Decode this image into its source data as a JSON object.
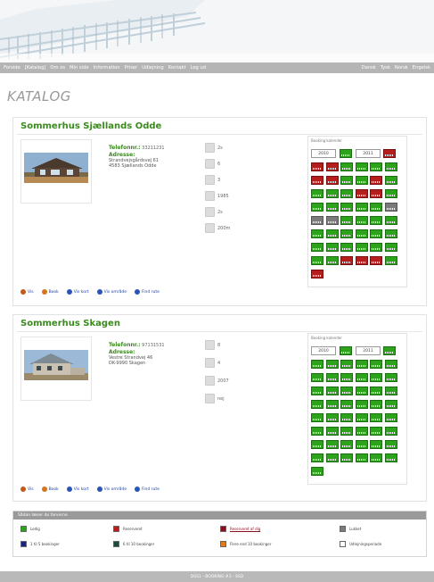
{
  "nav": {
    "left": [
      "Forside",
      "[Katalog]",
      "Om os",
      "Min side",
      "Information",
      "Priser",
      "Udlejning",
      "Kontakt",
      "Log ud"
    ],
    "right": [
      "Dansk",
      "Tysk",
      "Norsk",
      "Engelsk"
    ]
  },
  "page_title": "KATALOG",
  "properties": [
    {
      "title": "Sommerhus Sjællands Odde",
      "phone_label": "Telefonnr.:",
      "phone": "33211231",
      "address_label": "Adresse:",
      "address": [
        "Strandvejsgårdsvej 61",
        "4583 Sjællands Odde"
      ],
      "facts": [
        {
          "icon": "beds-icon",
          "value": "2s"
        },
        {
          "icon": "persons-icon",
          "value": "6"
        },
        {
          "icon": "bath-icon",
          "value": "3"
        },
        {
          "icon": "calendar-icon",
          "value": "1985"
        },
        {
          "icon": "plane-icon",
          "value": "2s"
        },
        {
          "icon": "distance-icon",
          "value": "200m"
        }
      ],
      "calendar": {
        "title": "Booking kalender",
        "years": [
          "2010",
          "2011"
        ],
        "weeks": [
          {
            "n": "",
            "st": "ledig"
          },
          {
            "n": "",
            "st": "reserveret"
          },
          {
            "n": "1",
            "st": "reserveret"
          },
          {
            "n": "2",
            "st": "reserveret"
          },
          {
            "n": "3",
            "st": "ledig"
          },
          {
            "n": "4",
            "st": "ledig"
          },
          {
            "n": "5",
            "st": "ledig"
          },
          {
            "n": "6",
            "st": "ledig"
          },
          {
            "n": "7",
            "st": "reserveret"
          },
          {
            "n": "8",
            "st": "reserveret"
          },
          {
            "n": "9",
            "st": "ledig"
          },
          {
            "n": "10",
            "st": "ledig"
          },
          {
            "n": "11",
            "st": "reserveret"
          },
          {
            "n": "12",
            "st": "ledig"
          },
          {
            "n": "13",
            "st": "ledig"
          },
          {
            "n": "14",
            "st": "ledig"
          },
          {
            "n": "15",
            "st": "ledig"
          },
          {
            "n": "16",
            "st": "reserveret"
          },
          {
            "n": "17",
            "st": "reserveret"
          },
          {
            "n": "18",
            "st": "ledig"
          },
          {
            "n": "19",
            "st": "ledig"
          },
          {
            "n": "20",
            "st": "ledig"
          },
          {
            "n": "21",
            "st": "ledig"
          },
          {
            "n": "22",
            "st": "ledig"
          },
          {
            "n": "23",
            "st": "ledig"
          },
          {
            "n": "24",
            "st": "lukket"
          },
          {
            "n": "25",
            "st": "lukket"
          },
          {
            "n": "26",
            "st": "lukket"
          },
          {
            "n": "27",
            "st": "ledig"
          },
          {
            "n": "28",
            "st": "ledig"
          },
          {
            "n": "29",
            "st": "ledig"
          },
          {
            "n": "30",
            "st": "ledig"
          },
          {
            "n": "31",
            "st": "ledig"
          },
          {
            "n": "32",
            "st": "ledig"
          },
          {
            "n": "33",
            "st": "ledig"
          },
          {
            "n": "34",
            "st": "ledig"
          },
          {
            "n": "35",
            "st": "ledig"
          },
          {
            "n": "36",
            "st": "ledig"
          },
          {
            "n": "37",
            "st": "ledig"
          },
          {
            "n": "38",
            "st": "ledig"
          },
          {
            "n": "39",
            "st": "ledig"
          },
          {
            "n": "40",
            "st": "ledig"
          },
          {
            "n": "41",
            "st": "ledig"
          },
          {
            "n": "42",
            "st": "ledig"
          },
          {
            "n": "43",
            "st": "ledig"
          },
          {
            "n": "44",
            "st": "ledig"
          },
          {
            "n": "45",
            "st": "reserveret"
          },
          {
            "n": "46",
            "st": "reserveret"
          },
          {
            "n": "47",
            "st": "reserveret"
          },
          {
            "n": "48",
            "st": "ledig"
          },
          {
            "n": "49",
            "st": "reserveret"
          }
        ]
      },
      "links": [
        "Vis",
        "Book",
        "Vis kort",
        "Vis område",
        "Find rute"
      ]
    },
    {
      "title": "Sommerhus Skagen",
      "phone_label": "Telefonnr.:",
      "phone": "97131531",
      "address_label": "Adresse:",
      "address": [
        "Vestre Strandvej 46",
        "DK-9990 Skagen"
      ],
      "facts": [
        {
          "icon": "beds-icon",
          "value": "8"
        },
        {
          "icon": "persons-icon",
          "value": "4"
        },
        {
          "icon": "calendar-icon",
          "value": "2007"
        },
        {
          "icon": "plane-icon",
          "value": "nej"
        }
      ],
      "calendar": {
        "title": "Booking kalender",
        "years": [
          "2010",
          "2011"
        ],
        "weeks": [
          {
            "n": "",
            "st": "ledig"
          },
          {
            "n": "",
            "st": "ledig"
          },
          {
            "n": "1",
            "st": "ledig"
          },
          {
            "n": "2",
            "st": "ledig"
          },
          {
            "n": "3",
            "st": "ledig"
          },
          {
            "n": "4",
            "st": "ledig"
          },
          {
            "n": "5",
            "st": "ledig"
          },
          {
            "n": "6",
            "st": "ledig"
          },
          {
            "n": "7",
            "st": "ledig"
          },
          {
            "n": "8",
            "st": "ledig"
          },
          {
            "n": "9",
            "st": "ledig"
          },
          {
            "n": "10",
            "st": "ledig"
          },
          {
            "n": "11",
            "st": "ledig"
          },
          {
            "n": "12",
            "st": "ledig"
          },
          {
            "n": "13",
            "st": "ledig"
          },
          {
            "n": "14",
            "st": "ledig"
          },
          {
            "n": "15",
            "st": "ledig"
          },
          {
            "n": "16",
            "st": "ledig"
          },
          {
            "n": "17",
            "st": "ledig"
          },
          {
            "n": "18",
            "st": "ledig"
          },
          {
            "n": "19",
            "st": "ledig"
          },
          {
            "n": "20",
            "st": "ledig"
          },
          {
            "n": "21",
            "st": "ledig"
          },
          {
            "n": "22",
            "st": "ledig"
          },
          {
            "n": "23",
            "st": "ledig"
          },
          {
            "n": "24",
            "st": "ledig"
          },
          {
            "n": "25",
            "st": "ledig"
          },
          {
            "n": "26",
            "st": "ledig"
          },
          {
            "n": "27",
            "st": "ledig"
          },
          {
            "n": "28",
            "st": "ledig"
          },
          {
            "n": "29",
            "st": "ledig"
          },
          {
            "n": "30",
            "st": "ledig"
          },
          {
            "n": "31",
            "st": "ledig"
          },
          {
            "n": "32",
            "st": "ledig"
          },
          {
            "n": "33",
            "st": "ledig"
          },
          {
            "n": "34",
            "st": "ledig"
          },
          {
            "n": "35",
            "st": "ledig"
          },
          {
            "n": "36",
            "st": "ledig"
          },
          {
            "n": "37",
            "st": "ledig"
          },
          {
            "n": "38",
            "st": "ledig"
          },
          {
            "n": "39",
            "st": "ledig"
          },
          {
            "n": "40",
            "st": "ledig"
          },
          {
            "n": "41",
            "st": "ledig"
          },
          {
            "n": "42",
            "st": "ledig"
          },
          {
            "n": "43",
            "st": "ledig"
          },
          {
            "n": "44",
            "st": "ledig"
          },
          {
            "n": "45",
            "st": "ledig"
          },
          {
            "n": "46",
            "st": "ledig"
          },
          {
            "n": "47",
            "st": "ledig"
          },
          {
            "n": "48",
            "st": "ledig"
          },
          {
            "n": "49",
            "st": "ledig"
          }
        ]
      },
      "links": [
        "Vis",
        "Book",
        "Vis kort",
        "Vis område",
        "Find rute"
      ]
    }
  ],
  "legend": {
    "title": "Sådan læser du farverne",
    "items": [
      {
        "label": "Ledig",
        "color": "#2ca31b"
      },
      {
        "label": "Reserveret",
        "color": "#b61e1e"
      },
      {
        "label": "Reserveret af dig",
        "color": "#8a1020"
      },
      {
        "label": "Lukket",
        "color": "#7b7b7b"
      },
      {
        "label": "1 til 5 bookinger",
        "color": "#1a237e"
      },
      {
        "label": "6 til 10 bookinger",
        "color": "#1b4d3e"
      },
      {
        "label": "Flere end 10 bookinger",
        "color": "#e07a1f"
      },
      {
        "label": "Udlejningsperiode",
        "color": "#ffffff"
      }
    ]
  },
  "footer": "DSS1 - BOOKING #3 - SSD"
}
